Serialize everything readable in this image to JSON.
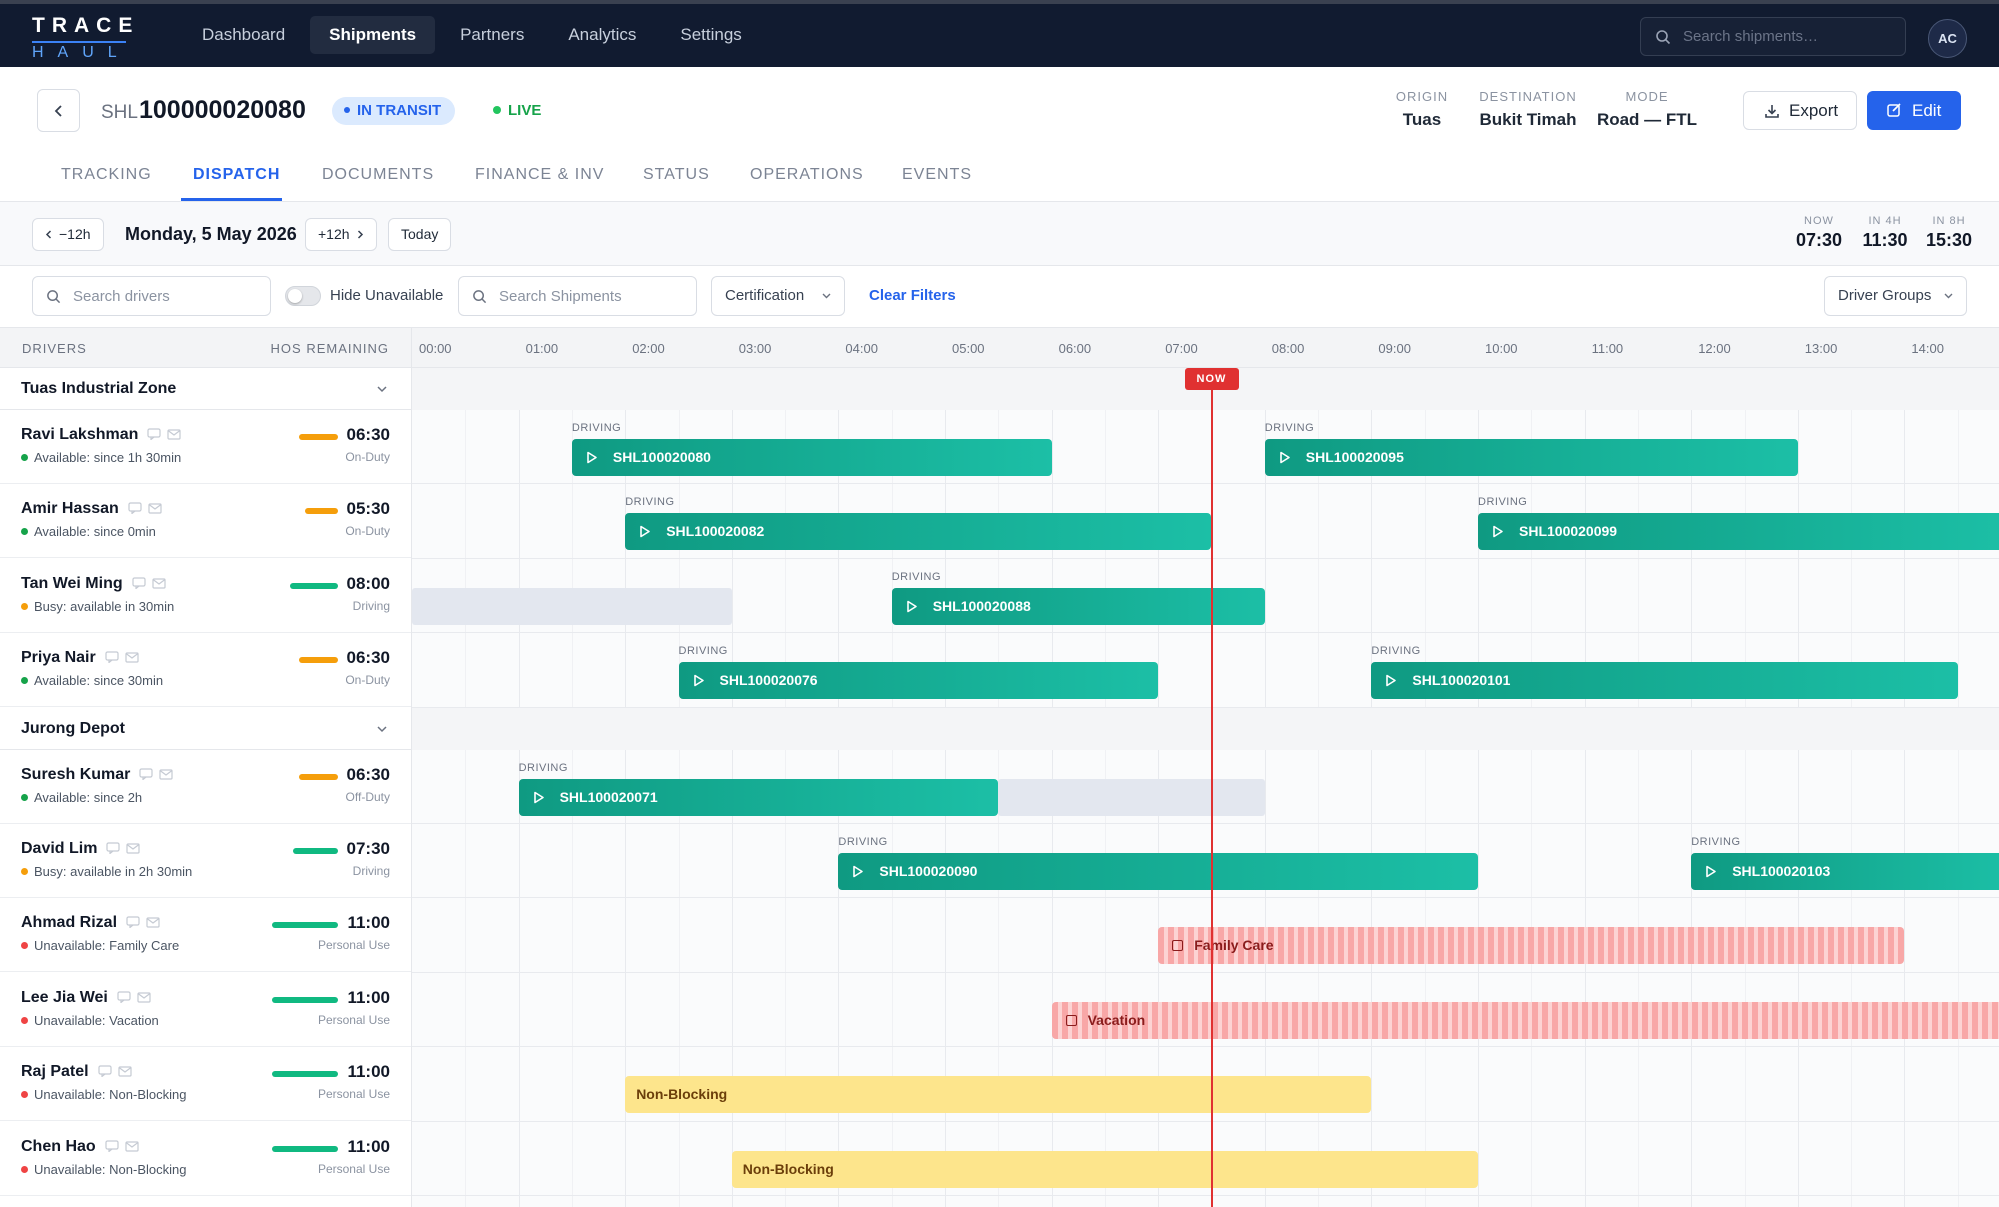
{
  "app": {
    "logo_top": "TRACE",
    "logo_bottom": "HAUL",
    "nav": [
      {
        "label": "Dashboard"
      },
      {
        "label": "Shipments"
      },
      {
        "label": "Partners"
      },
      {
        "label": "Analytics"
      },
      {
        "label": "Settings"
      }
    ],
    "active_nav": "Shipments",
    "search_placeholder": "Search shipments…",
    "avatar": "AC"
  },
  "shipment": {
    "prefix": "SHL",
    "number": "100000020080",
    "status": "IN TRANSIT",
    "live": "LIVE",
    "origin_label": "ORIGIN",
    "origin": "Tuas",
    "destination_label": "DESTINATION",
    "destination": "Bukit Timah",
    "mode_label": "MODE",
    "mode": "Road — FTL",
    "export_label": "Export",
    "edit_label": "Edit"
  },
  "tabs": [
    {
      "label": "TRACKING"
    },
    {
      "label": "DISPATCH"
    },
    {
      "label": "DOCUMENTS"
    },
    {
      "label": "FINANCE & INV"
    },
    {
      "label": "STATUS"
    },
    {
      "label": "OPERATIONS"
    },
    {
      "label": "EVENTS"
    }
  ],
  "active_tab": "DISPATCH",
  "dispatch": {
    "back_label": "−12h",
    "forward_label": "+12h",
    "today_label": "Today",
    "date": "Monday, 5 May 2026",
    "clocks": [
      {
        "label": "NOW",
        "value": "07:30"
      },
      {
        "label": "IN 4H",
        "value": "11:30"
      },
      {
        "label": "IN 8H",
        "value": "15:30"
      }
    ],
    "filters": {
      "driver_search_placeholder": "Search drivers",
      "hide_unavailable_label": "Hide Unavailable",
      "hide_unavailable": false,
      "shipment_search_placeholder": "Search Shipments",
      "certification_label": "Certification",
      "clear_label": "Clear Filters",
      "driver_groups_label": "Driver Groups"
    },
    "columns": {
      "drivers": "DRIVERS",
      "hos": "HOS REMAINING"
    },
    "hours": [
      "00:00",
      "01:00",
      "02:00",
      "03:00",
      "04:00",
      "05:00",
      "06:00",
      "07:00",
      "08:00",
      "09:00",
      "10:00",
      "11:00",
      "12:00",
      "13:00",
      "14:00"
    ],
    "now_label": "NOW",
    "now_time": 7.5,
    "groups": [
      {
        "name": "Tuas Industrial Zone"
      },
      {
        "name": "Jurong Depot"
      }
    ],
    "drivers": [
      {
        "name": "Ravi Lakshman",
        "status": "Available: since 1h 30min",
        "status_color": "#16a34a",
        "hos": "06:30",
        "hos_label": "On-Duty",
        "hos_fraction": 0.59,
        "hos_color": "#f59e0b"
      },
      {
        "name": "Amir Hassan",
        "status": "Available: since 0min",
        "status_color": "#16a34a",
        "hos": "05:30",
        "hos_label": "On-Duty",
        "hos_fraction": 0.5,
        "hos_color": "#f59e0b"
      },
      {
        "name": "Tan Wei Ming",
        "status": "Busy: available in 30min",
        "status_color": "#f59e0b",
        "hos": "08:00",
        "hos_label": "Driving",
        "hos_fraction": 0.73,
        "hos_color": "#10b981"
      },
      {
        "name": "Priya Nair",
        "status": "Available: since 30min",
        "status_color": "#16a34a",
        "hos": "06:30",
        "hos_label": "On-Duty",
        "hos_fraction": 0.59,
        "hos_color": "#f59e0b"
      },
      {
        "name": "Suresh Kumar",
        "status": "Available: since 2h",
        "status_color": "#16a34a",
        "hos": "06:30",
        "hos_label": "Off-Duty",
        "hos_fraction": 0.59,
        "hos_color": "#f59e0b"
      },
      {
        "name": "David Lim",
        "status": "Busy: available in 2h 30min",
        "status_color": "#f59e0b",
        "hos": "07:30",
        "hos_label": "Driving",
        "hos_fraction": 0.68,
        "hos_color": "#10b981"
      },
      {
        "name": "Ahmad Rizal",
        "status": "Unavailable: Family Care",
        "status_color": "#ef4444",
        "hos": "11:00",
        "hos_label": "Personal Use",
        "hos_fraction": 1.0,
        "hos_color": "#10b981"
      },
      {
        "name": "Lee Jia Wei",
        "status": "Unavailable: Vacation",
        "status_color": "#ef4444",
        "hos": "11:00",
        "hos_label": "Personal Use",
        "hos_fraction": 1.0,
        "hos_color": "#10b981"
      },
      {
        "name": "Raj Patel",
        "status": "Unavailable: Non-Blocking",
        "status_color": "#ef4444",
        "hos": "11:00",
        "hos_label": "Personal Use",
        "hos_fraction": 1.0,
        "hos_color": "#10b981"
      },
      {
        "name": "Chen Hao",
        "status": "Unavailable: Non-Blocking",
        "status_color": "#ef4444",
        "hos": "11:00",
        "hos_label": "Personal Use",
        "hos_fraction": 1.0,
        "hos_color": "#10b981"
      }
    ],
    "assignments": [
      {
        "driver": 0,
        "kind": "driving",
        "label": "SHL100020080",
        "tag": "DRIVING",
        "start": 1.5,
        "end": 6.0
      },
      {
        "driver": 0,
        "kind": "driving",
        "label": "SHL100020095",
        "tag": "DRIVING",
        "start": 8.0,
        "end": 13.0
      },
      {
        "driver": 1,
        "kind": "driving",
        "label": "SHL100020082",
        "tag": "DRIVING",
        "start": 2.0,
        "end": 7.5
      },
      {
        "driver": 1,
        "kind": "driving",
        "label": "SHL100020099",
        "tag": "DRIVING",
        "start": 10.0,
        "end": 15.0
      },
      {
        "driver": 2,
        "kind": "idle",
        "start": 0.0,
        "end": 3.0
      },
      {
        "driver": 2,
        "kind": "driving",
        "label": "SHL100020088",
        "tag": "DRIVING",
        "start": 4.5,
        "end": 8.0
      },
      {
        "driver": 3,
        "kind": "driving",
        "label": "SHL100020076",
        "tag": "DRIVING",
        "start": 2.5,
        "end": 7.0
      },
      {
        "driver": 3,
        "kind": "driving",
        "label": "SHL100020101",
        "tag": "DRIVING",
        "start": 9.0,
        "end": 14.5
      },
      {
        "driver": 4,
        "kind": "idle",
        "start": 5.5,
        "end": 8.0
      },
      {
        "driver": 4,
        "kind": "driving",
        "label": "SHL100020071",
        "tag": "DRIVING",
        "start": 1.0,
        "end": 5.5
      },
      {
        "driver": 5,
        "kind": "driving",
        "label": "SHL100020090",
        "tag": "DRIVING",
        "start": 4.0,
        "end": 10.0
      },
      {
        "driver": 5,
        "kind": "driving",
        "label": "SHL100020103",
        "tag": "DRIVING",
        "start": 12.0,
        "end": 15.0
      },
      {
        "driver": 6,
        "kind": "unavailable",
        "label": "Family Care",
        "start": 7.0,
        "end": 14.0
      },
      {
        "driver": 7,
        "kind": "unavailable",
        "label": "Vacation",
        "start": 6.0,
        "end": 15.0
      },
      {
        "driver": 8,
        "kind": "nonblocking",
        "label": "Non-Blocking",
        "start": 2.0,
        "end": 9.0
      },
      {
        "driver": 9,
        "kind": "nonblocking",
        "label": "Non-Blocking",
        "start": 3.0,
        "end": 10.0
      }
    ]
  }
}
